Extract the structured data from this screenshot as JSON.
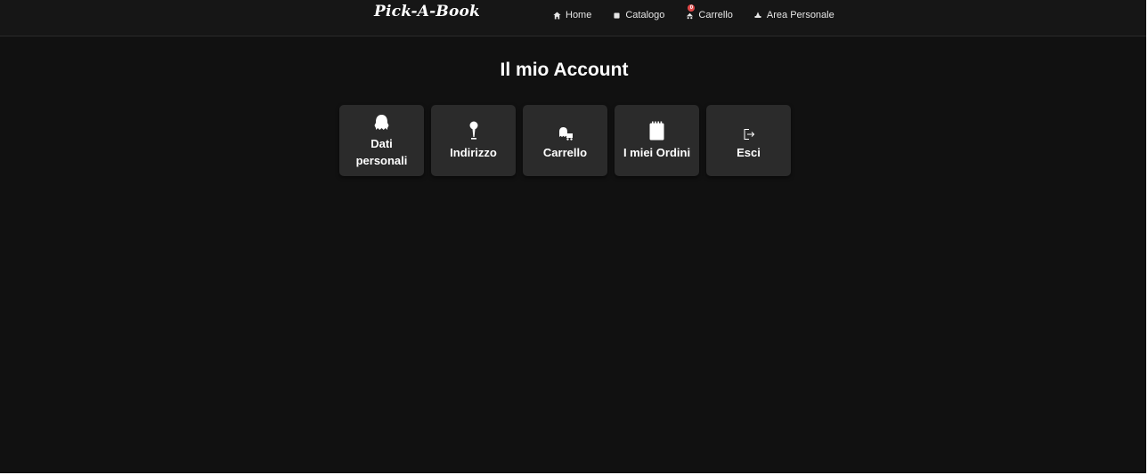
{
  "header": {
    "brand": "Pick-A-Book",
    "nav": [
      {
        "label": "Home",
        "icon": "home-icon"
      },
      {
        "label": "Catalogo",
        "icon": "book-icon"
      },
      {
        "label": "Carrello",
        "icon": "cart-icon",
        "badge": "0"
      },
      {
        "label": "Area Personale",
        "icon": "user-icon"
      }
    ]
  },
  "main": {
    "title": "Il mio Account",
    "cards": [
      {
        "label": "Dati personali",
        "icon": "ghost-icon"
      },
      {
        "label": "Indirizzo",
        "icon": "map-pin-icon"
      },
      {
        "label": "Carrello",
        "icon": "cart-icon"
      },
      {
        "label": "I miei Ordini",
        "icon": "notepad-icon"
      },
      {
        "label": "Esci",
        "icon": "logout-icon"
      }
    ]
  },
  "colors": {
    "background": "#111111",
    "card": "#2b2b2b",
    "badge": "#e24a4a",
    "text": "#ffffff"
  }
}
